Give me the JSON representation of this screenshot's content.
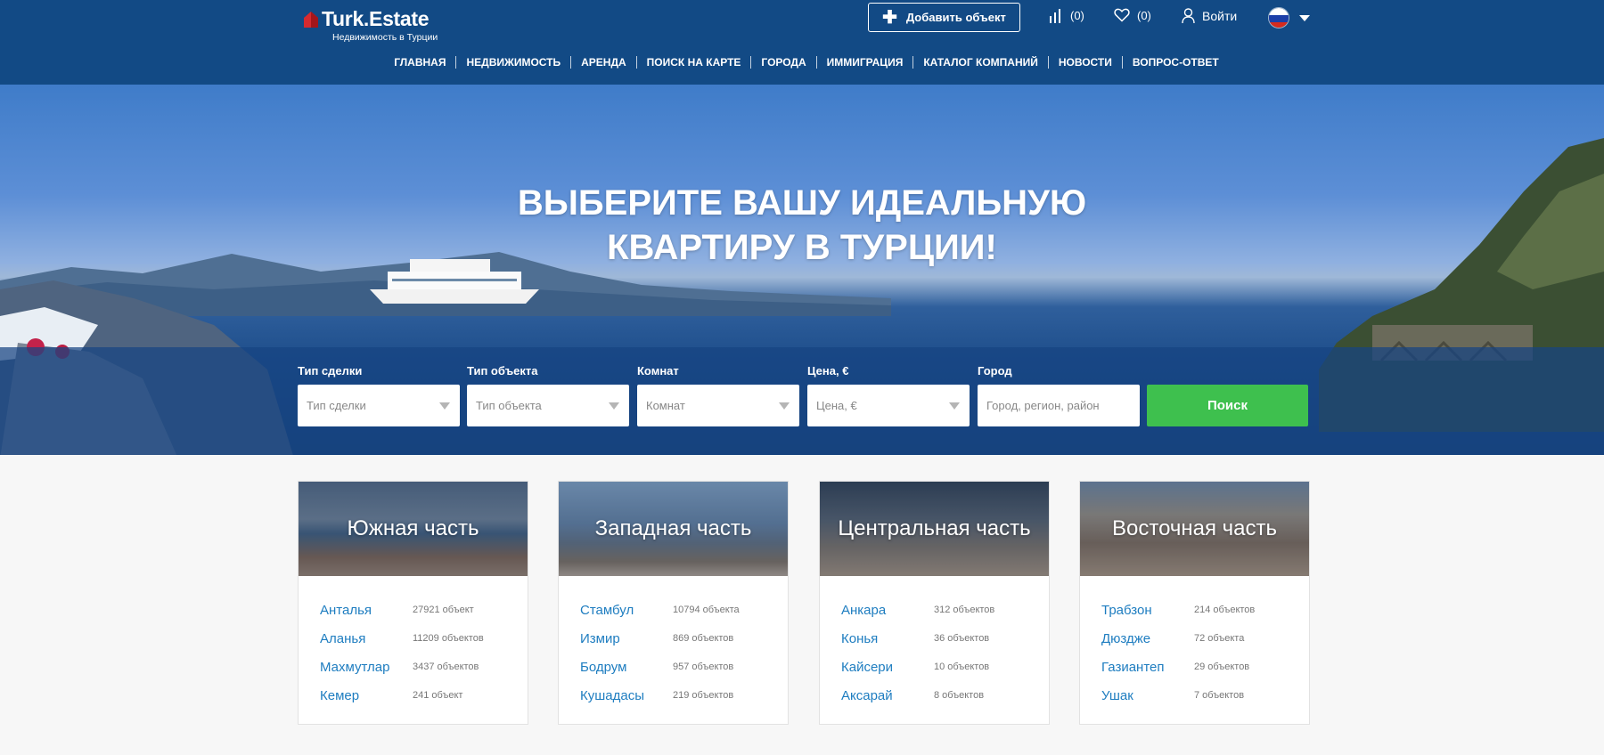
{
  "header": {
    "logo_text": "Turk.Estate",
    "logo_sub": "Недвижимость в Турции",
    "add_button": "Добавить объект",
    "compare_count": "(0)",
    "favorites_count": "(0)",
    "login": "Войти"
  },
  "nav": [
    "ГЛАВНАЯ",
    "НЕДВИЖИМОСТЬ",
    "АРЕНДА",
    "ПОИСК НА КАРТЕ",
    "ГОРОДА",
    "ИММИГРАЦИЯ",
    "КАТАЛОГ КОМПАНИЙ",
    "НОВОСТИ",
    "ВОПРОС-ОТВЕТ"
  ],
  "hero": {
    "title_line1": "ВЫБЕРИТЕ ВАШУ ИДЕАЛЬНУЮ",
    "title_line2": "КВАРТИРУ В ТУРЦИИ!"
  },
  "search": {
    "deal_label": "Тип сделки",
    "deal_placeholder": "Тип сделки",
    "object_label": "Тип объекта",
    "object_placeholder": "Тип объекта",
    "rooms_label": "Комнат",
    "rooms_placeholder": "Комнат",
    "price_label": "Цена, €",
    "price_placeholder": "Цена, €",
    "city_label": "Город",
    "city_placeholder": "Город, регион, район",
    "button": "Поиск"
  },
  "regions": [
    {
      "title": "Южная часть",
      "cities": [
        {
          "name": "Анталья",
          "count": "27921 объект"
        },
        {
          "name": "Аланья",
          "count": "11209 объектов"
        },
        {
          "name": "Махмутлар",
          "count": "3437 объектов"
        },
        {
          "name": "Кемер",
          "count": "241 объект"
        }
      ]
    },
    {
      "title": "Западная часть",
      "cities": [
        {
          "name": "Стамбул",
          "count": "10794 объекта"
        },
        {
          "name": "Измир",
          "count": "869 объектов"
        },
        {
          "name": "Бодрум",
          "count": "957 объектов"
        },
        {
          "name": "Кушадасы",
          "count": "219 объектов"
        }
      ]
    },
    {
      "title": "Центральная часть",
      "cities": [
        {
          "name": "Анкара",
          "count": "312 объектов"
        },
        {
          "name": "Конья",
          "count": "36 объектов"
        },
        {
          "name": "Кайсери",
          "count": "10 объектов"
        },
        {
          "name": "Аксарай",
          "count": "8 объектов"
        }
      ]
    },
    {
      "title": "Восточная часть",
      "cities": [
        {
          "name": "Трабзон",
          "count": "214 объектов"
        },
        {
          "name": "Дюздже",
          "count": "72 объекта"
        },
        {
          "name": "Газиантеп",
          "count": "29 объектов"
        },
        {
          "name": "Ушак",
          "count": "7 объектов"
        }
      ]
    }
  ],
  "colors": {
    "header_bg": "#124a85",
    "search_button": "#3ec04e",
    "city_link": "#1e7dc0"
  },
  "icons": [
    "house-logo-icon",
    "plus-icon",
    "bar-chart-icon",
    "heart-icon",
    "user-icon",
    "russia-flag-icon",
    "caret-down-icon"
  ]
}
